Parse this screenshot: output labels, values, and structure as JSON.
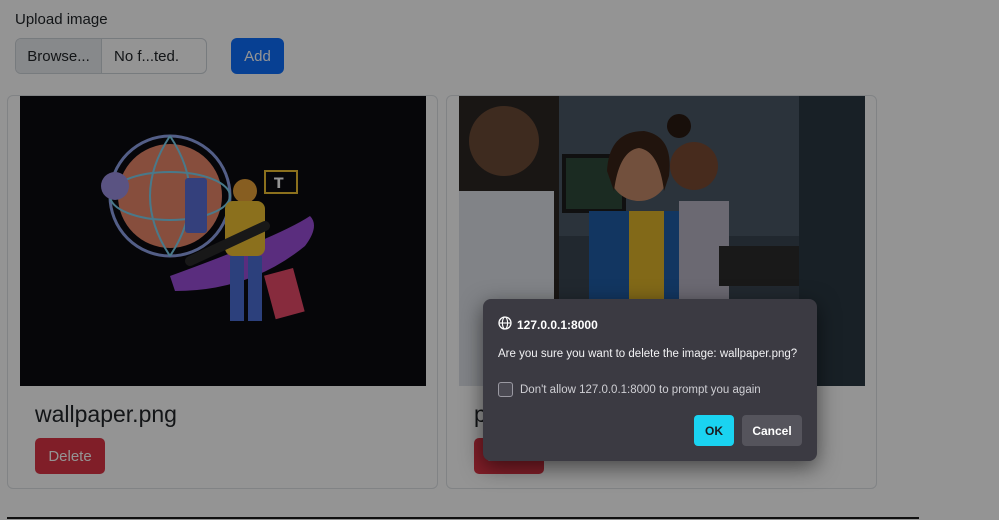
{
  "upload": {
    "label": "Upload image",
    "browse_label": "Browse...",
    "file_name": "No f...ted.",
    "add_label": "Add"
  },
  "cards": [
    {
      "title": "wallpaper.png",
      "delete_label": "Delete",
      "image_icon": "illustration-image"
    },
    {
      "title": "p",
      "delete_label": "Delete",
      "image_icon": "office-photo-image"
    }
  ],
  "dialog": {
    "origin": "127.0.0.1:8000",
    "message": "Are you sure you want to delete the image: wallpaper.png?",
    "checkbox_label": "Don't allow 127.0.0.1:8000 to prompt you again",
    "ok_label": "OK",
    "cancel_label": "Cancel",
    "origin_icon": "globe-icon"
  },
  "colors": {
    "primary": "#0d6efd",
    "danger": "#dc3545",
    "dialog_bg": "#3b3a42",
    "ok_button": "#1ad3f1"
  }
}
